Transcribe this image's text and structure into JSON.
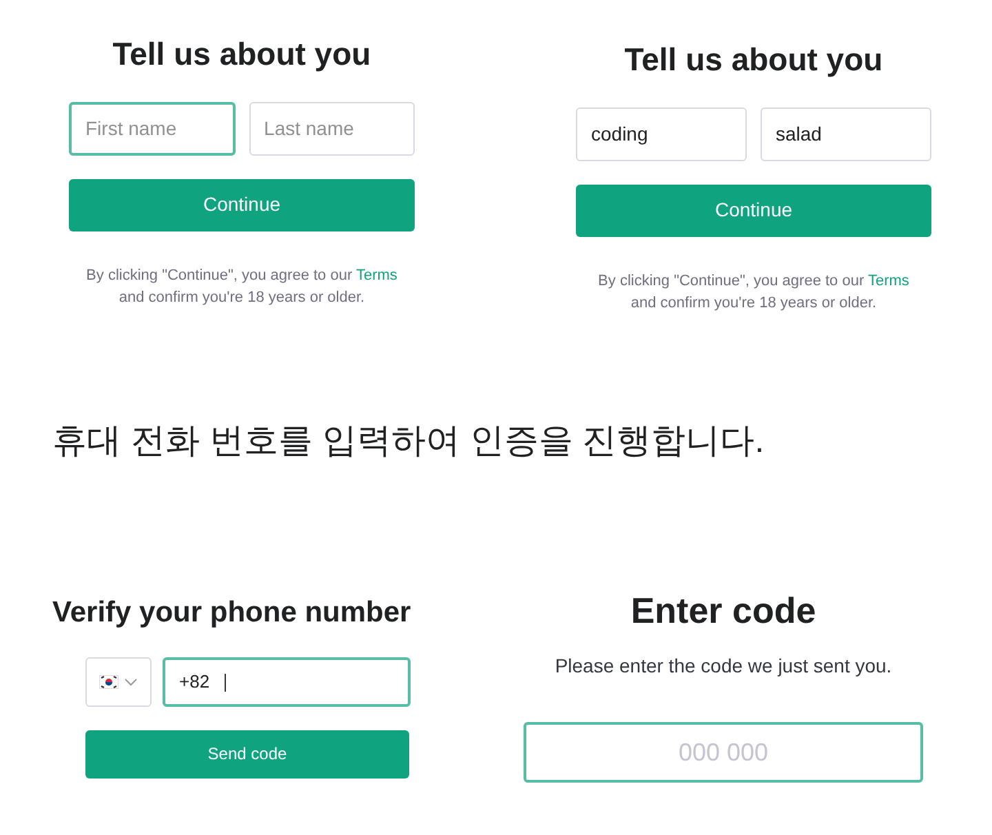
{
  "name_forms": [
    {
      "title": "Tell us about you",
      "fields": [
        {
          "placeholder": "First name",
          "focused": true
        },
        {
          "placeholder": "Last name",
          "focused": false
        }
      ],
      "button": "Continue",
      "legal": "By clicking \"Continue\", you agree to our",
      "legal_link": "Terms",
      "legal_line_2": "and confirm you're 18 years or older."
    },
    {
      "title": "Tell us about you",
      "fields": [
        {
          "value": "coding",
          "focused": false
        },
        {
          "value": "salad",
          "focused": false
        }
      ],
      "button": "Continue",
      "legal": "By clicking \"Continue\", you agree to our",
      "legal_link": "Terms",
      "legal_line_2": "and confirm you're 18 years or older."
    }
  ],
  "caption": "휴대 전화 번호를 입력하여 인증을 진행합니다.",
  "phone_form": {
    "title": "Verify your phone number",
    "phone_field": {
      "value": "+82",
      "focused": true
    },
    "button": "Send code"
  },
  "code_form": {
    "title": "Enter code",
    "subtitle": "Please enter the code we just sent you.",
    "code_field": {
      "placeholder": "000 000",
      "focused": true
    }
  }
}
